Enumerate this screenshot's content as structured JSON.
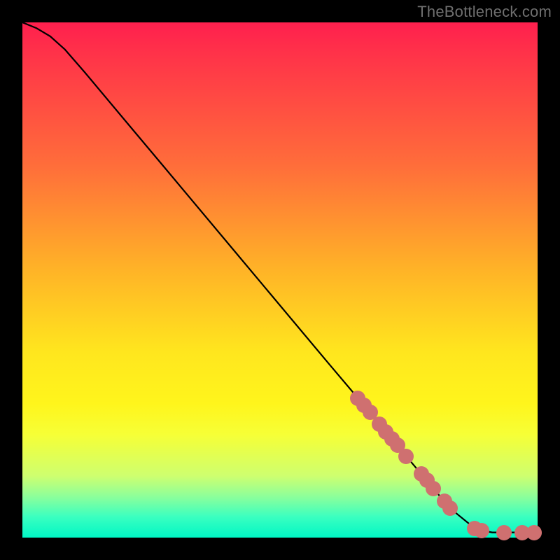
{
  "attribution": "TheBottleneck.com",
  "chart_data": {
    "type": "line",
    "title": "",
    "xlabel": "",
    "ylabel": "",
    "xlim": [
      0,
      100
    ],
    "ylim": [
      0,
      100
    ],
    "grid": false,
    "legend": false,
    "series": [
      {
        "name": "curve",
        "x": [
          0.0,
          2.7,
          5.4,
          8.2,
          12.2,
          20.4,
          27.2,
          42.1,
          59.6,
          65.1,
          74.5,
          83.0,
          87.8,
          89.1,
          91.2,
          93.5,
          97.0,
          99.3,
          100.0
        ],
        "y": [
          100.0,
          98.9,
          97.3,
          94.8,
          90.2,
          80.4,
          72.3,
          54.5,
          33.6,
          27.1,
          15.8,
          5.7,
          1.8,
          1.4,
          1.0,
          1.0,
          1.0,
          1.0,
          1.0
        ]
      }
    ],
    "markers": [
      {
        "x": 65.1,
        "y": 27.1
      },
      {
        "x": 66.3,
        "y": 25.7
      },
      {
        "x": 67.5,
        "y": 24.3
      },
      {
        "x": 69.3,
        "y": 22.0
      },
      {
        "x": 70.5,
        "y": 20.5
      },
      {
        "x": 71.7,
        "y": 19.2
      },
      {
        "x": 72.8,
        "y": 17.9
      },
      {
        "x": 74.5,
        "y": 15.8
      },
      {
        "x": 77.4,
        "y": 12.4
      },
      {
        "x": 78.5,
        "y": 11.1
      },
      {
        "x": 79.8,
        "y": 9.5
      },
      {
        "x": 81.9,
        "y": 7.1
      },
      {
        "x": 83.0,
        "y": 5.7
      },
      {
        "x": 87.8,
        "y": 1.8
      },
      {
        "x": 89.1,
        "y": 1.4
      },
      {
        "x": 93.5,
        "y": 1.0
      },
      {
        "x": 97.0,
        "y": 1.0
      },
      {
        "x": 99.3,
        "y": 1.0
      }
    ],
    "gradient_stops": [
      {
        "pos": 0,
        "color": "#ff1f4e"
      },
      {
        "pos": 28,
        "color": "#ff6e3a"
      },
      {
        "pos": 48,
        "color": "#ffb327"
      },
      {
        "pos": 64,
        "color": "#ffe61e"
      },
      {
        "pos": 80,
        "color": "#f6ff36"
      },
      {
        "pos": 92,
        "color": "#8dff9a"
      },
      {
        "pos": 100,
        "color": "#00f7c5"
      }
    ]
  }
}
